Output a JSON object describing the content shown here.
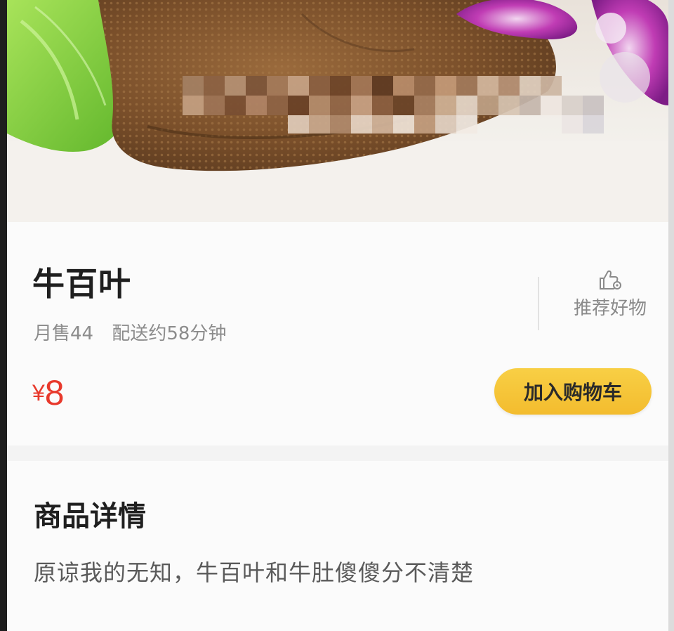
{
  "product": {
    "name": "牛百叶",
    "monthly_sales": "月售44",
    "delivery_time": "配送约58分钟",
    "price_currency": "¥",
    "price_value": "8"
  },
  "actions": {
    "recommend_label": "推荐好物",
    "add_to_cart_label": "加入购物车"
  },
  "details": {
    "heading": "商品详情",
    "description": "原谅我的无知，牛百叶和牛肚傻傻分不清楚"
  },
  "colors": {
    "price": "#e8392c",
    "cart_button": "#f5c338",
    "title_text": "#1f1f1f",
    "meta_text": "#8c8c8c"
  },
  "icons": {
    "recommend": "thumbs-up-icon"
  }
}
